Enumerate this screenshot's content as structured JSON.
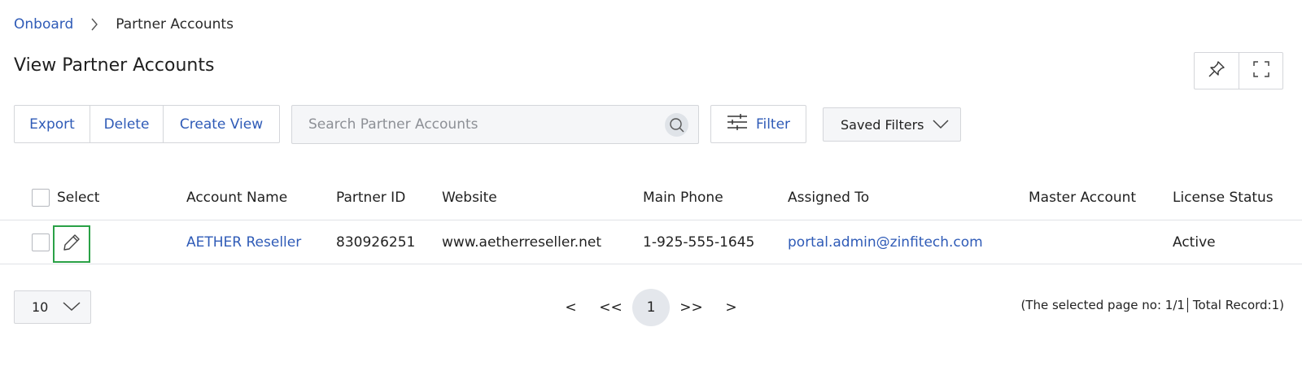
{
  "breadcrumb": {
    "root": "Onboard",
    "current": "Partner Accounts"
  },
  "page": {
    "title": "View Partner Accounts"
  },
  "toolbar": {
    "export_label": "Export",
    "delete_label": "Delete",
    "create_view_label": "Create View",
    "search_placeholder": "Search Partner Accounts",
    "search_value": "",
    "filter_label": "Filter",
    "saved_filters_label": "Saved Filters"
  },
  "table": {
    "columns": {
      "select": "Select",
      "account_name": "Account Name",
      "partner_id": "Partner ID",
      "website": "Website",
      "main_phone": "Main Phone",
      "assigned_to": "Assigned To",
      "master_account": "Master Account",
      "license_status": "License Status"
    },
    "rows": [
      {
        "account_name": "AETHER Reseller",
        "partner_id": "830926251",
        "website": "www.aetherreseller.net",
        "main_phone": "1-925-555-1645",
        "assigned_to": "portal.admin@zinfitech.com",
        "master_account": "",
        "license_status": "Active"
      }
    ]
  },
  "pagination": {
    "page_size": "10",
    "prev": "<",
    "first": "<<",
    "current_page": "1",
    "last": ">>",
    "next": ">",
    "selected_page_text": "(The selected page no: 1/1",
    "total_text": "Total Record:1)"
  },
  "colors": {
    "link": "#2f5bb7",
    "highlight": "#2aa146",
    "border": "#d4d6da"
  },
  "icons": [
    "chevron-right-icon",
    "pin-icon",
    "fullscreen-icon",
    "search-icon",
    "filter-sliders-icon",
    "chevron-down-icon",
    "pencil-icon"
  ]
}
